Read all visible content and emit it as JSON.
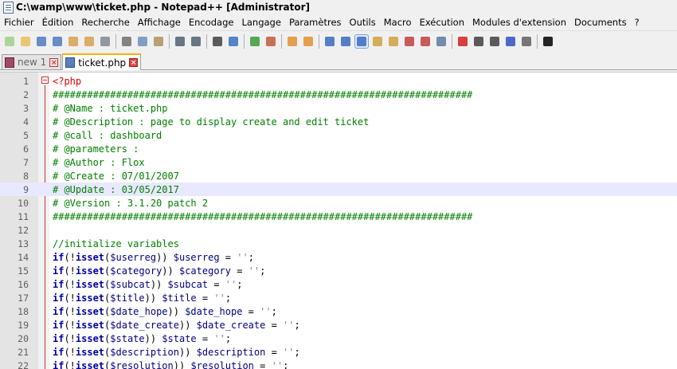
{
  "window": {
    "title": "C:\\wamp\\www\\ticket.php - Notepad++ [Administrator]"
  },
  "menu": [
    "Fichier",
    "Édition",
    "Recherche",
    "Affichage",
    "Encodage",
    "Langage",
    "Paramètres",
    "Outils",
    "Macro",
    "Exécution",
    "Modules d'extension",
    "Documents",
    "?"
  ],
  "toolbar": [
    {
      "name": "new-file-icon",
      "color": "#9fd08a"
    },
    {
      "name": "open-file-icon",
      "color": "#e8c15a"
    },
    {
      "name": "save-icon",
      "color": "#4f7ac0"
    },
    {
      "name": "save-all-icon",
      "color": "#4f7ac0"
    },
    {
      "name": "close-icon",
      "color": "#d8a050"
    },
    {
      "name": "close-all-icon",
      "color": "#d8a050"
    },
    {
      "name": "print-icon",
      "color": "#808890"
    },
    {
      "sep": true
    },
    {
      "name": "cut-icon",
      "color": "#707070"
    },
    {
      "name": "copy-icon",
      "color": "#6f8fbf"
    },
    {
      "name": "paste-icon",
      "color": "#b09060"
    },
    {
      "sep": true
    },
    {
      "name": "undo-icon",
      "color": "#506070"
    },
    {
      "name": "redo-icon",
      "color": "#506070"
    },
    {
      "sep": true
    },
    {
      "name": "find-icon",
      "color": "#404040"
    },
    {
      "name": "replace-icon",
      "color": "#3a70c0"
    },
    {
      "sep": true
    },
    {
      "name": "zoom-in-icon",
      "color": "#3a9a3a"
    },
    {
      "name": "zoom-out-icon",
      "color": "#c05a3a"
    },
    {
      "sep": true
    },
    {
      "name": "sync-vertical-icon",
      "color": "#e09030"
    },
    {
      "name": "sync-horizontal-icon",
      "color": "#e09030"
    },
    {
      "sep": true
    },
    {
      "name": "word-wrap-icon",
      "color": "#3a6ac0"
    },
    {
      "name": "show-all-chars-icon",
      "color": "#3a6ac0"
    },
    {
      "name": "indent-guide-icon",
      "color": "#3a6ac0",
      "active": true
    },
    {
      "name": "user-language-icon",
      "color": "#d0a040"
    },
    {
      "name": "document-map-icon",
      "color": "#d0a040"
    },
    {
      "name": "function-list-icon",
      "color": "#c04040"
    },
    {
      "name": "folder-workspace-icon",
      "color": "#c04040"
    },
    {
      "name": "monitoring-eye-icon",
      "color": "#5a7aa0"
    },
    {
      "sep": true
    },
    {
      "name": "record-macro-icon",
      "color": "#d02020"
    },
    {
      "name": "stop-macro-icon",
      "color": "#404040"
    },
    {
      "name": "play-macro-icon",
      "color": "#404040"
    },
    {
      "name": "run-macro-multiple-icon",
      "color": "#3050c0"
    },
    {
      "name": "save-macro-icon",
      "color": "#606060"
    },
    {
      "sep": true
    },
    {
      "name": "black-square-icon",
      "color": "#000000"
    }
  ],
  "tabs": [
    {
      "label": "new 1",
      "active": false
    },
    {
      "label": "ticket.php",
      "active": true
    }
  ],
  "editor": {
    "current_line": 9,
    "lines": [
      [
        [
          "php",
          "<?php"
        ]
      ],
      [
        [
          "cm",
          "#########################################################################"
        ]
      ],
      [
        [
          "cm",
          "# @Name : ticket.php"
        ]
      ],
      [
        [
          "cm",
          "# @Description : page to display create and edit ticket"
        ]
      ],
      [
        [
          "cm",
          "# @call : dashboard"
        ]
      ],
      [
        [
          "cm",
          "# @parameters :"
        ]
      ],
      [
        [
          "cm",
          "# @Author : Flox"
        ]
      ],
      [
        [
          "cm",
          "# @Create : 07/01/2007"
        ]
      ],
      [
        [
          "cm",
          "# @Update : 03/05/2017"
        ]
      ],
      [
        [
          "cm",
          "# @Version : 3.1.20 patch 2"
        ]
      ],
      [
        [
          "cm",
          "#########################################################################"
        ]
      ],
      [
        [
          "pl",
          ""
        ]
      ],
      [
        [
          "cm",
          "//initialize variables"
        ]
      ],
      [
        [
          "kw",
          "if"
        ],
        [
          "pl",
          "(!"
        ],
        [
          "kw",
          "isset"
        ],
        [
          "pl",
          "("
        ],
        [
          "var",
          "$userreg"
        ],
        [
          "pl",
          ")) "
        ],
        [
          "var",
          "$userreg"
        ],
        [
          "pl",
          " = "
        ],
        [
          "str",
          "''"
        ],
        [
          "pl",
          ";"
        ]
      ],
      [
        [
          "kw",
          "if"
        ],
        [
          "pl",
          "(!"
        ],
        [
          "kw",
          "isset"
        ],
        [
          "pl",
          "("
        ],
        [
          "var",
          "$category"
        ],
        [
          "pl",
          ")) "
        ],
        [
          "var",
          "$category"
        ],
        [
          "pl",
          " = "
        ],
        [
          "str",
          "''"
        ],
        [
          "pl",
          ";"
        ]
      ],
      [
        [
          "kw",
          "if"
        ],
        [
          "pl",
          "(!"
        ],
        [
          "kw",
          "isset"
        ],
        [
          "pl",
          "("
        ],
        [
          "var",
          "$subcat"
        ],
        [
          "pl",
          ")) "
        ],
        [
          "var",
          "$subcat"
        ],
        [
          "pl",
          " = "
        ],
        [
          "str",
          "''"
        ],
        [
          "pl",
          ";"
        ]
      ],
      [
        [
          "kw",
          "if"
        ],
        [
          "pl",
          "(!"
        ],
        [
          "kw",
          "isset"
        ],
        [
          "pl",
          "("
        ],
        [
          "var",
          "$title"
        ],
        [
          "pl",
          ")) "
        ],
        [
          "var",
          "$title"
        ],
        [
          "pl",
          " = "
        ],
        [
          "str",
          "''"
        ],
        [
          "pl",
          ";"
        ]
      ],
      [
        [
          "kw",
          "if"
        ],
        [
          "pl",
          "(!"
        ],
        [
          "kw",
          "isset"
        ],
        [
          "pl",
          "("
        ],
        [
          "var",
          "$date_hope"
        ],
        [
          "pl",
          ")) "
        ],
        [
          "var",
          "$date_hope"
        ],
        [
          "pl",
          " = "
        ],
        [
          "str",
          "''"
        ],
        [
          "pl",
          ";"
        ]
      ],
      [
        [
          "kw",
          "if"
        ],
        [
          "pl",
          "(!"
        ],
        [
          "kw",
          "isset"
        ],
        [
          "pl",
          "("
        ],
        [
          "var",
          "$date_create"
        ],
        [
          "pl",
          ")) "
        ],
        [
          "var",
          "$date_create"
        ],
        [
          "pl",
          " = "
        ],
        [
          "str",
          "''"
        ],
        [
          "pl",
          ";"
        ]
      ],
      [
        [
          "kw",
          "if"
        ],
        [
          "pl",
          "(!"
        ],
        [
          "kw",
          "isset"
        ],
        [
          "pl",
          "("
        ],
        [
          "var",
          "$state"
        ],
        [
          "pl",
          ")) "
        ],
        [
          "var",
          "$state"
        ],
        [
          "pl",
          " = "
        ],
        [
          "str",
          "''"
        ],
        [
          "pl",
          ";"
        ]
      ],
      [
        [
          "kw",
          "if"
        ],
        [
          "pl",
          "(!"
        ],
        [
          "kw",
          "isset"
        ],
        [
          "pl",
          "("
        ],
        [
          "var",
          "$description"
        ],
        [
          "pl",
          ")) "
        ],
        [
          "var",
          "$description"
        ],
        [
          "pl",
          " = "
        ],
        [
          "str",
          "''"
        ],
        [
          "pl",
          ";"
        ]
      ],
      [
        [
          "kw",
          "if"
        ],
        [
          "pl",
          "(!"
        ],
        [
          "kw",
          "isset"
        ],
        [
          "pl",
          "("
        ],
        [
          "var",
          "$resolution"
        ],
        [
          "pl",
          ")) "
        ],
        [
          "var",
          "$resolution"
        ],
        [
          "pl",
          " = "
        ],
        [
          "str",
          "''"
        ],
        [
          "pl",
          ";"
        ]
      ]
    ]
  }
}
